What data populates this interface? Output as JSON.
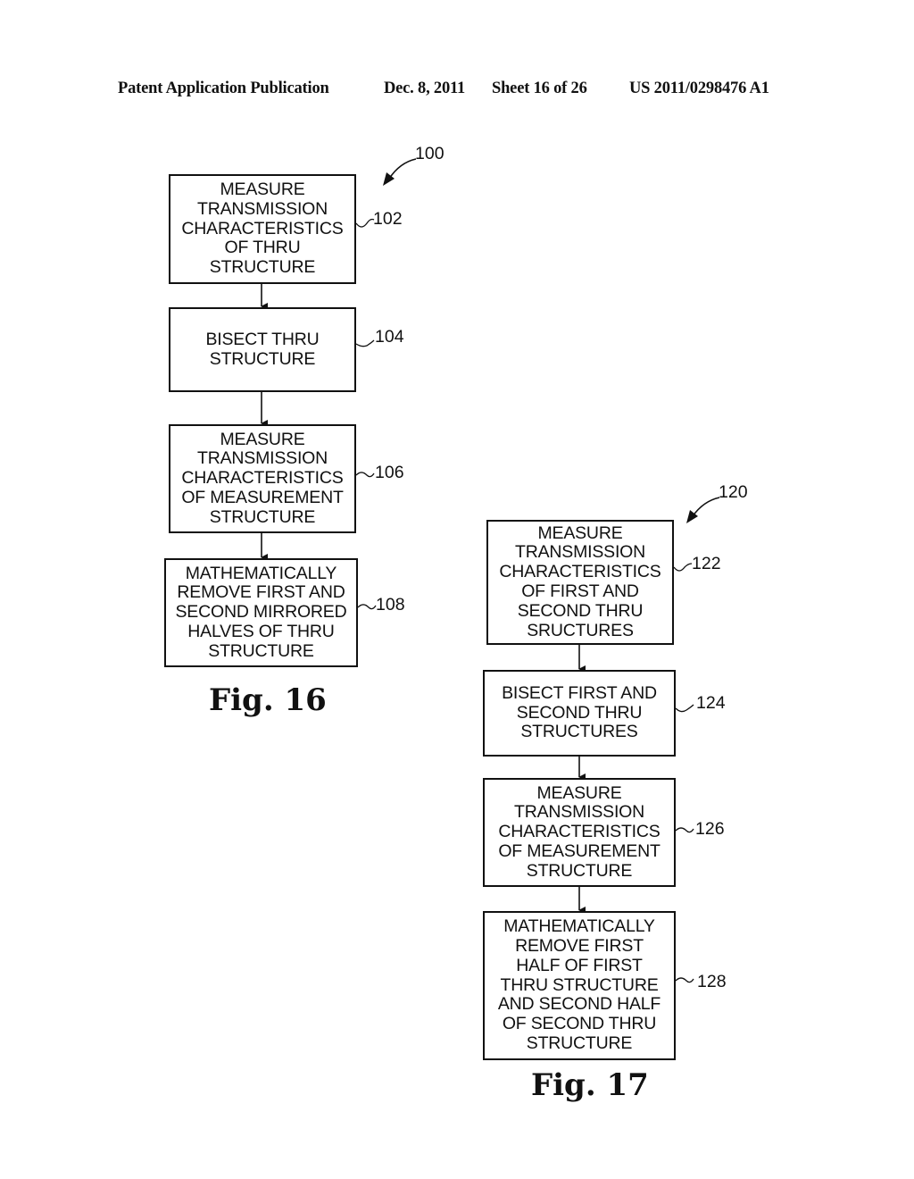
{
  "header": {
    "publication": "Patent Application Publication",
    "date": "Dec. 8, 2011",
    "sheet": "Sheet 16 of 26",
    "number": "US 2011/0298476 A1"
  },
  "fig16": {
    "ref": "100",
    "caption": "Fig. 16",
    "steps": [
      {
        "ref": "102",
        "text": "MEASURE\nTRANSMISSION\nCHARACTERISTICS\nOF THRU\nSTRUCTURE"
      },
      {
        "ref": "104",
        "text": "BISECT THRU\nSTRUCTURE"
      },
      {
        "ref": "106",
        "text": "MEASURE\nTRANSMISSION\nCHARACTERISTICS\nOF MEASUREMENT\nSTRUCTURE"
      },
      {
        "ref": "108",
        "text": "MATHEMATICALLY\nREMOVE FIRST AND\nSECOND MIRRORED\nHALVES OF THRU\nSTRUCTURE"
      }
    ]
  },
  "fig17": {
    "ref": "120",
    "caption": "Fig. 17",
    "steps": [
      {
        "ref": "122",
        "text": "MEASURE\nTRANSMISSION\nCHARACTERISTICS\nOF FIRST AND\nSECOND THRU\nSRUCTURES"
      },
      {
        "ref": "124",
        "text": "BISECT FIRST AND\nSECOND THRU\nSTRUCTURES"
      },
      {
        "ref": "126",
        "text": "MEASURE\nTRANSMISSION\nCHARACTERISTICS\nOF MEASUREMENT\nSTRUCTURE"
      },
      {
        "ref": "128",
        "text": "MATHEMATICALLY\nREMOVE FIRST\nHALF OF FIRST\nTHRU STRUCTURE\nAND SECOND HALF\nOF SECOND THRU\nSTRUCTURE"
      }
    ]
  }
}
